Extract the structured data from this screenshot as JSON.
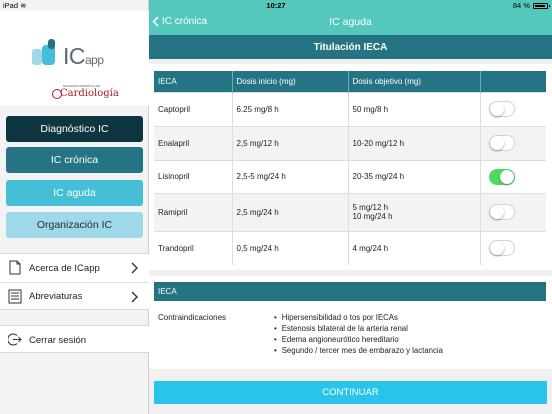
{
  "status": {
    "device": "iPad",
    "time": "10:27",
    "battery": "84 %"
  },
  "sidebar": {
    "logo_text": "IC",
    "logo_sub": "app",
    "seal_top": "SOCIEDAD ESPAÑOLA DE",
    "seal_name": "Cardiología",
    "menu": [
      {
        "label": "Diagnóstico IC"
      },
      {
        "label": "IC crónica"
      },
      {
        "label": "IC aguda"
      },
      {
        "label": "Organización IC"
      }
    ],
    "links": [
      {
        "label": "Acerca de ICapp"
      },
      {
        "label": "Abreviaturas"
      }
    ],
    "logout": "Cerrar sesión",
    "colors": {
      "btn1": "#0d3640",
      "btn2": "#247483",
      "btn3": "#45bed7",
      "btn4": "#9fd8e9"
    }
  },
  "navbar": {
    "back_label": "IC crónica",
    "title": "IC aguda",
    "color": "#55c8bd"
  },
  "subbar": {
    "title": "Titulación IECA"
  },
  "table": {
    "headers": [
      "IECA",
      "Dosis inicio (mg)",
      "Dosis objetivo (mg)",
      ""
    ],
    "rows": [
      {
        "drug": "Captopril",
        "start": "6.25 mg/8 h",
        "target1": "50 mg/8 h",
        "target2": "",
        "on": false
      },
      {
        "drug": "Enalapril",
        "start": "2,5 mg/12 h",
        "target1": "10-20 mg/12 h",
        "target2": "",
        "on": false
      },
      {
        "drug": "Lisinopril",
        "start": "2,5-5 mg/24 h",
        "target1": "20-35 mg/24 h",
        "target2": "",
        "on": true
      },
      {
        "drug": "Ramipril",
        "start": "2,5 mg/24 h",
        "target1": "5 mg/12 h",
        "target2": "10 mg/24 h",
        "on": false
      },
      {
        "drug": "Trandopril",
        "start": "0,5 mg/24 h",
        "target1": "4 mg/24 h",
        "target2": "",
        "on": false
      }
    ]
  },
  "contra": {
    "header": "IECA",
    "label": "Contraindicaciones",
    "items": [
      "Hipersensibilidad o tos por IECAs",
      "Estenosis bilateral de la arteria renal",
      "Edema angioneurótico hereditario",
      "Segundo / tercer mes de embarazo y lactancia"
    ]
  },
  "continue_label": "CONTINUAR"
}
